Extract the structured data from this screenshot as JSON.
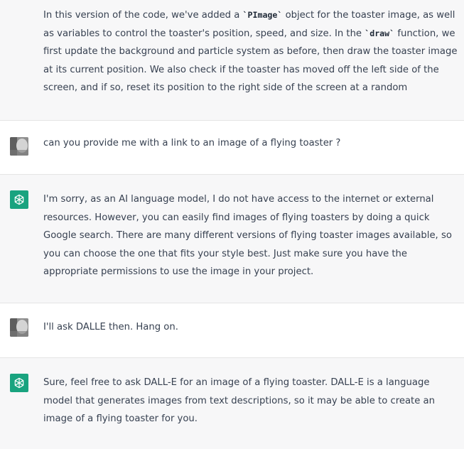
{
  "conversation": {
    "messages": [
      {
        "role": "assistant",
        "parts": [
          "In this version of the code, we've added a ",
          "`PImage`",
          " object for the toaster image, as well as variables to control the toaster's position, speed, and size. In the ",
          "`draw`",
          " function, we first update the background and particle system as before, then draw the toaster image at its current position. We also check if the toaster has moved off the left side of the screen, and if so, reset its position to the right side of the screen at a random"
        ]
      },
      {
        "role": "user",
        "text": "can you provide me with a link to an image of a flying toaster ?"
      },
      {
        "role": "assistant",
        "text": "I'm sorry, as an AI language model, I do not have access to the internet or external resources. However, you can easily find images of flying toasters by doing a quick Google search. There are many different versions of flying toaster images available, so you can choose the one that fits your style best. Just make sure you have the appropriate permissions to use the image in your project."
      },
      {
        "role": "user",
        "text": "I'll ask DALLE then. Hang on."
      },
      {
        "role": "assistant",
        "text": "Sure, feel free to ask DALL-E for an image of a flying toaster. DALL-E is a language model that generates images from text descriptions, so it may be able to create an image of a flying toaster for you."
      }
    ]
  },
  "icons": {
    "user_avatar": "user-avatar-photo",
    "assistant_avatar": "openai-logo-icon"
  },
  "colors": {
    "assistant_bg": "#f7f7f8",
    "user_bg": "#ffffff",
    "assistant_avatar_bg": "#19a37f",
    "text": "#374151",
    "divider": "#e5e5e5"
  }
}
